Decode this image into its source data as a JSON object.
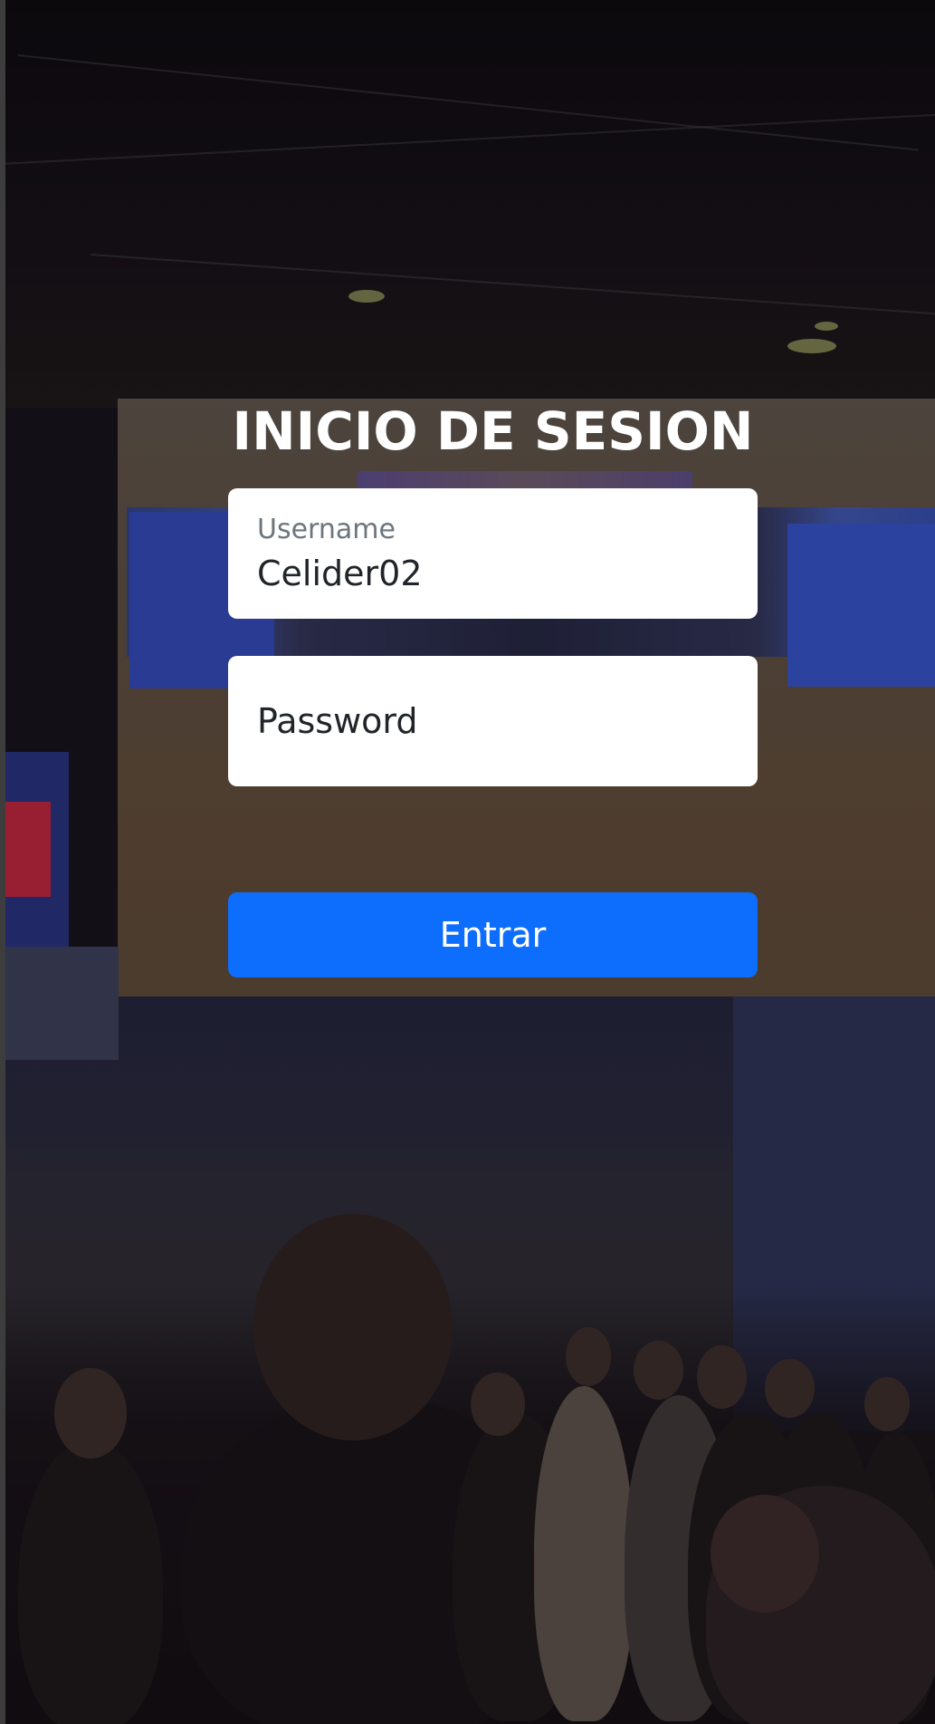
{
  "login": {
    "title": "INICIO DE SESION",
    "username": {
      "label": "Username",
      "value": "Celider02"
    },
    "password": {
      "placeholder": "Password",
      "value": ""
    },
    "submit_label": "Entrar"
  },
  "colors": {
    "primary": "#0d6efd",
    "field_background": "#ffffff",
    "title_text": "#ffffff"
  }
}
